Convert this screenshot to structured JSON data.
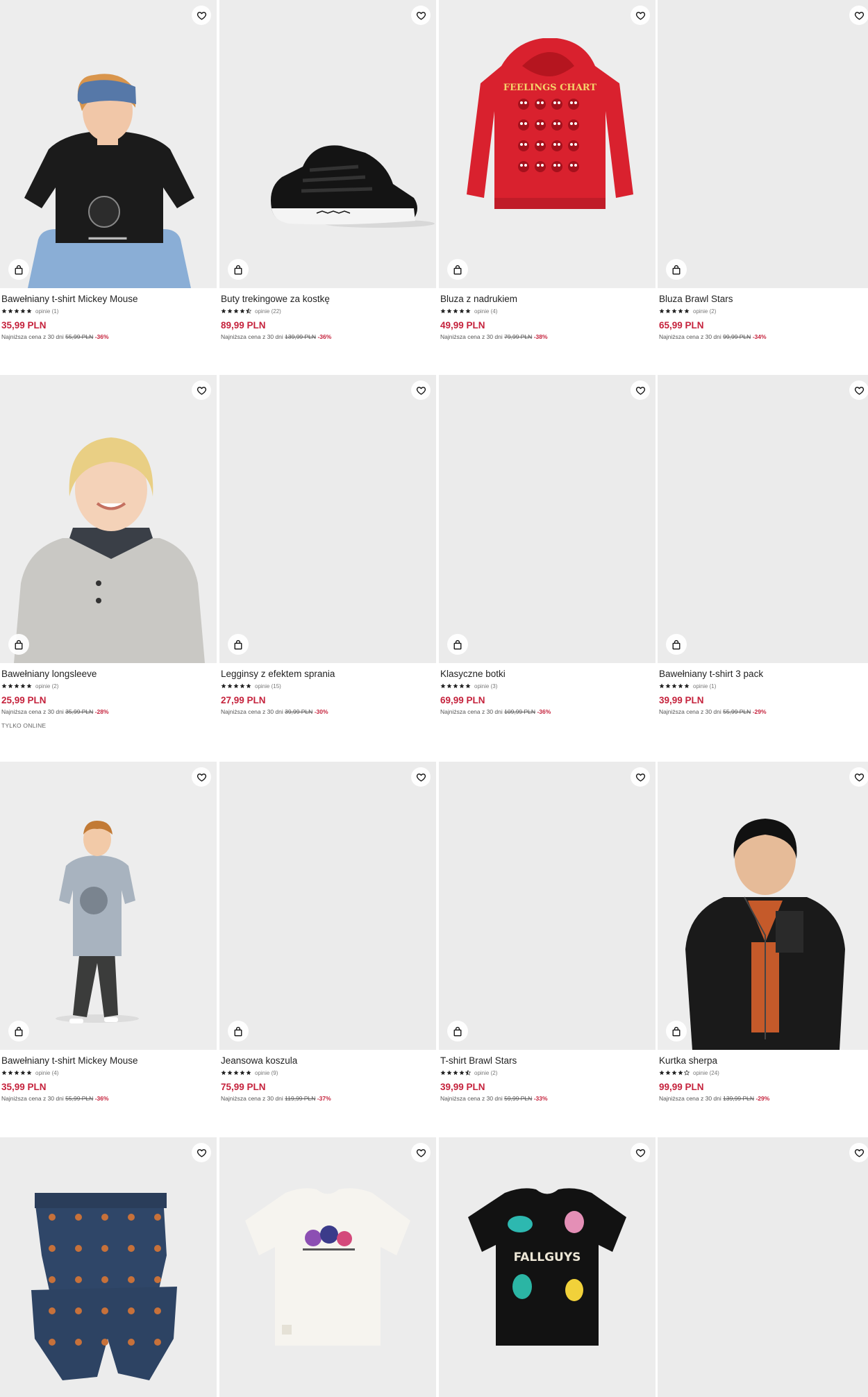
{
  "colors": {
    "price": "#c5223c",
    "image_bg": "#ebebeb",
    "star": "#222222"
  },
  "lowest_label": "Najniższa cena z 30 dni",
  "products": [
    {
      "name": "Bawełniany t-shirt Mickey Mouse",
      "rating": 5,
      "reviews": "opinie (1)",
      "price": "35,99 PLN",
      "old_price": "55,99 PLN",
      "discount": "-36%",
      "image": "boy-black-tshirt"
    },
    {
      "name": "Buty trekingowe za kostkę",
      "rating": 4.5,
      "reviews": "opinie (22)",
      "price": "89,99 PLN",
      "old_price": "139,99 PLN",
      "discount": "-36%",
      "image": "black-trekking-shoe"
    },
    {
      "name": "Bluza z nadrukiem",
      "rating": 5,
      "reviews": "opinie (4)",
      "price": "49,99 PLN",
      "old_price": "79,99 PLN",
      "discount": "-38%",
      "image": "red-hoodie"
    },
    {
      "name": "Bluza Brawl Stars",
      "rating": 5,
      "reviews": "opinie (2)",
      "price": "65,99 PLN",
      "old_price": "99,99 PLN",
      "discount": "-34%",
      "image": "blank"
    },
    {
      "name": "Bawełniany longsleeve",
      "rating": 5,
      "reviews": "opinie (2)",
      "price": "25,99 PLN",
      "old_price": "35,99 PLN",
      "discount": "-28%",
      "badge": "TYLKO ONLINE",
      "image": "boy-grey-polo"
    },
    {
      "name": "Legginsy z efektem sprania",
      "rating": 5,
      "reviews": "opinie (15)",
      "price": "27,99 PLN",
      "old_price": "39,99 PLN",
      "discount": "-30%",
      "image": "blank"
    },
    {
      "name": "Klasyczne botki",
      "rating": 5,
      "reviews": "opinie (3)",
      "price": "69,99 PLN",
      "old_price": "109,99 PLN",
      "discount": "-36%",
      "image": "blank"
    },
    {
      "name": "Bawełniany t-shirt 3 pack",
      "rating": 5,
      "reviews": "opinie (1)",
      "price": "39,99 PLN",
      "old_price": "55,99 PLN",
      "discount": "-29%",
      "image": "blank"
    },
    {
      "name": "Bawełniany t-shirt Mickey Mouse",
      "rating": 5,
      "reviews": "opinie (4)",
      "price": "35,99 PLN",
      "old_price": "55,99 PLN",
      "discount": "-36%",
      "image": "boy-tiedye-tshirt"
    },
    {
      "name": "Jeansowa koszula",
      "rating": 5,
      "reviews": "opinie (9)",
      "price": "75,99 PLN",
      "old_price": "119,99 PLN",
      "discount": "-37%",
      "image": "blank"
    },
    {
      "name": "T-shirt Brawl Stars",
      "rating": 4.5,
      "reviews": "opinie (2)",
      "price": "39,99 PLN",
      "old_price": "59,99 PLN",
      "discount": "-33%",
      "image": "blank"
    },
    {
      "name": "Kurtka sherpa",
      "rating": 4,
      "reviews": "opinie (24)",
      "price": "99,99 PLN",
      "old_price": "139,99 PLN",
      "discount": "-29%",
      "image": "boy-black-sherpa"
    },
    {
      "name": "",
      "image": "navy-boxers"
    },
    {
      "name": "",
      "image": "white-tshirt"
    },
    {
      "name": "",
      "image": "black-tshirt-fallguys"
    },
    {
      "name": "",
      "image": "blank"
    }
  ],
  "art_text": {
    "hoodie_print": "FEELINGS CHART",
    "fallguys_print": "FALLGUYS"
  }
}
